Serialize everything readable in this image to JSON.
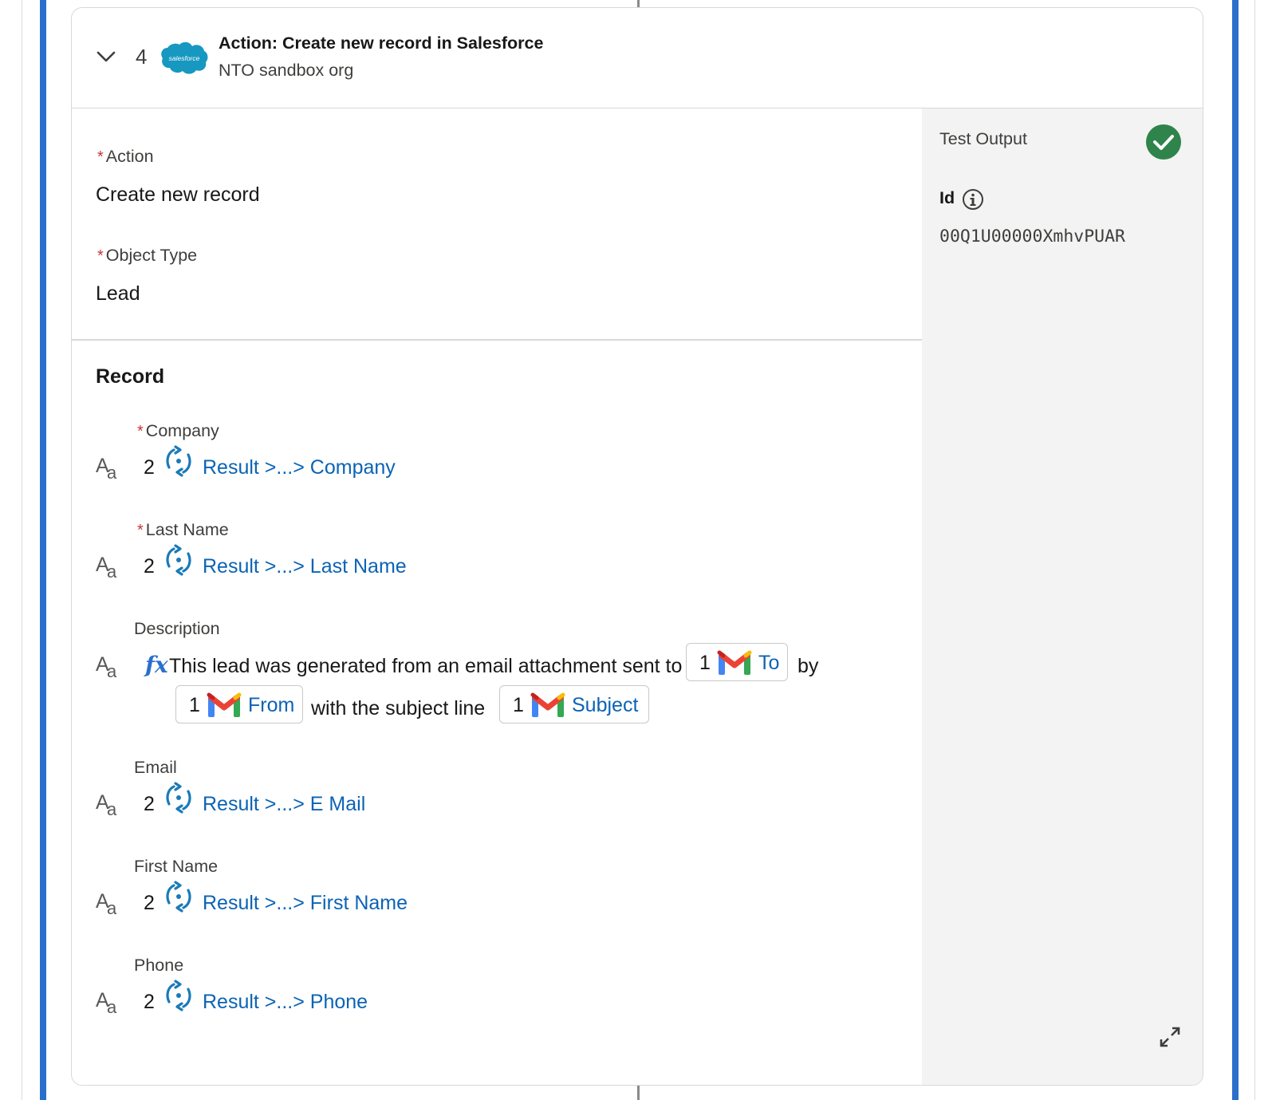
{
  "header": {
    "step_number": "4",
    "app_logo_text": "salesforce",
    "title": "Action: Create new record in Salesforce",
    "subtitle": "NTO sandbox org"
  },
  "config": {
    "action_label": "Action",
    "action_value": "Create new record",
    "object_type_label": "Object Type",
    "object_type_value": "Lead",
    "required_marker": "*"
  },
  "record": {
    "section_title": "Record",
    "type_icon_big": "A",
    "type_icon_small": "a",
    "fields": [
      {
        "label": "Company",
        "required": true,
        "step": "2",
        "value": "Result >...> Company"
      },
      {
        "label": "Last Name",
        "required": true,
        "step": "2",
        "value": "Result >...> Last Name"
      },
      {
        "label": "Email",
        "required": false,
        "step": "2",
        "value": "Result >...> E Mail"
      },
      {
        "label": "First Name",
        "required": false,
        "step": "2",
        "value": "Result >...> First Name"
      },
      {
        "label": "Phone",
        "required": false,
        "step": "2",
        "value": "Result >...> Phone"
      }
    ],
    "description": {
      "label": "Description",
      "fx": "fx",
      "text1": "This lead was generated from an email attachment sent to",
      "text2": "by",
      "text3": "with the subject line",
      "pills": [
        {
          "step": "1",
          "label": "To"
        },
        {
          "step": "1",
          "label": "From"
        },
        {
          "step": "1",
          "label": "Subject"
        }
      ]
    }
  },
  "test_output": {
    "title": "Test Output",
    "status": "success",
    "id_label": "Id",
    "id_value": "00Q1U00000XmhvPUAR"
  },
  "colors": {
    "accent_blue": "#2a6fcc",
    "link_blue": "#0b63b5",
    "success_green": "#2e844a",
    "required_red": "#c23934"
  },
  "icons": [
    "chevron-down-icon",
    "salesforce-logo",
    "mulesoft-icon",
    "gmail-icon",
    "fx-icon",
    "check-icon",
    "info-icon",
    "expand-icon",
    "text-type-icon"
  ]
}
